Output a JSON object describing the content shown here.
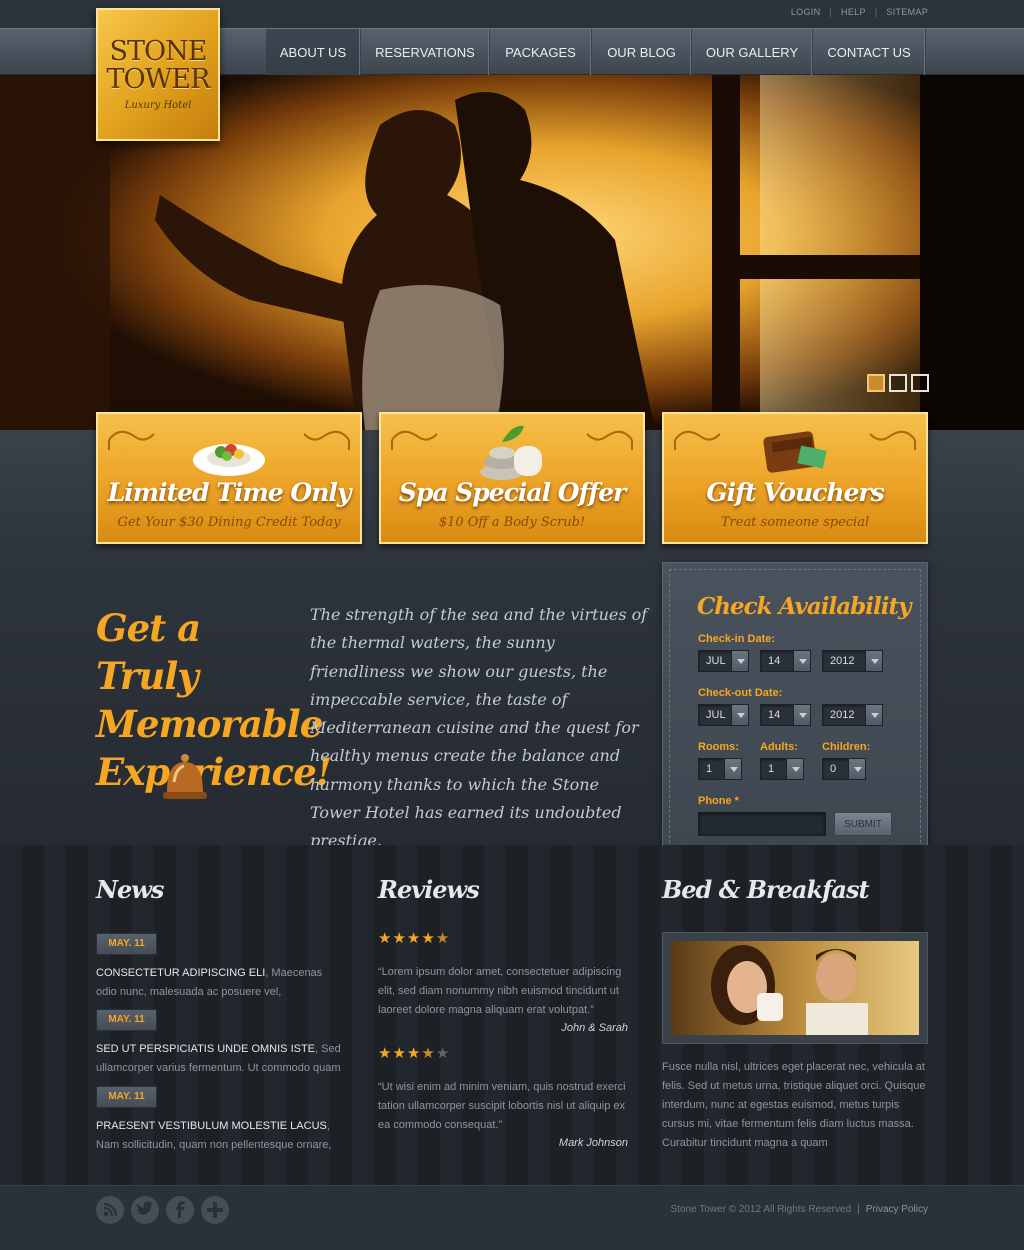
{
  "utility_links": [
    "LOGIN",
    "HELP",
    "SITEMAP"
  ],
  "logo": {
    "line1": "STONE",
    "line2": "TOWER",
    "tagline": "Luxury Hotel"
  },
  "nav": [
    "ABOUT US",
    "RESERVATIONS",
    "PACKAGES",
    "OUR BLOG",
    "OUR GALLERY",
    "CONTACT US"
  ],
  "slider": {
    "count": 3,
    "active": 1
  },
  "promos": [
    {
      "title": "Limited Time Only",
      "subtitle": "Get Your $30 Dining Credit Today"
    },
    {
      "title": "Spa Special Offer",
      "subtitle": "$10 Off a Body Scrub!"
    },
    {
      "title": "Gift Vouchers",
      "subtitle": "Treat someone special"
    }
  ],
  "headline": {
    "line1": "Get a Truly",
    "line2": "Memorable",
    "line3": "Experience!"
  },
  "intro": "The strength of the sea and the virtues of the thermal waters, the sunny friendliness we show our guests, the impeccable service, the taste of Mediterranean cuisine and the quest for healthy menus create the balance and harmony thanks to which the Stone Tower Hotel has earned its undoubted prestige.",
  "availability": {
    "title": "Check Availability",
    "checkin_label": "Check-in Date:",
    "checkin": {
      "month": "JUL",
      "day": "14",
      "year": "2012"
    },
    "checkout_label": "Check-out Date:",
    "checkout": {
      "month": "JUL",
      "day": "14",
      "year": "2012"
    },
    "rooms_label": "Rooms:",
    "rooms": "1",
    "adults_label": "Adults:",
    "adults": "1",
    "children_label": "Children:",
    "children": "0",
    "phone_label": "Phone *",
    "phone_value": "",
    "submit_label": "SUBMIT"
  },
  "news": {
    "title": "News",
    "items": [
      {
        "date": "MAY. 11",
        "heading": "CONSECTETUR ADIPISCING ELI",
        "text": ", Maecenas odio nunc, malesuada ac posuere vel,"
      },
      {
        "date": "MAY. 11",
        "heading": "SED UT PERSPICIATIS UNDE OMNIS ISTE",
        "text": ", Sed ullamcorper varius fermentum. Ut commodo quam"
      },
      {
        "date": "MAY. 11",
        "heading": "PRAESENT VESTIBULUM MOLESTIE LACUS",
        "text": ", Nam sollicitudin, quam non pellentesque ornare,"
      }
    ]
  },
  "reviews": {
    "title": "Reviews",
    "items": [
      {
        "rating": 4.5,
        "quote": "“Lorem ipsum dolor amet, consectetuer adipiscing elit, sed diam nonummy nibh euismod tincidunt ut laoreet dolore magna aliquam erat volutpat.”",
        "author": "John & Sarah"
      },
      {
        "rating": 3.5,
        "quote": "“Ut wisi enim ad minim veniam, quis nostrud exerci tation ullamcorper suscipit lobortis nisl ut aliquip ex ea commodo consequat.”",
        "author": "Mark Johnson"
      }
    ]
  },
  "bnb": {
    "title": "Bed & Breakfast",
    "text": "Fusce nulla nisl, ultrices eget placerat nec, vehicula at felis. Sed ut metus urna, tristique aliquet orci. Quisque interdum, nunc at egestas euismod, metus turpis cursus mi, vitae fermentum felis diam luctus massa. Curabitur tincidunt magna a quam"
  },
  "footer": {
    "copyright": "Stone Tower © 2012 All Rights Reserved",
    "privacy": "Privacy Policy",
    "social_icons": [
      "rss-icon",
      "twitter-icon",
      "facebook-icon",
      "google-plus-icon"
    ]
  },
  "colors": {
    "accent": "#f5a623",
    "promo_gold": "#eda529",
    "dark_bg": "#2a3038"
  }
}
